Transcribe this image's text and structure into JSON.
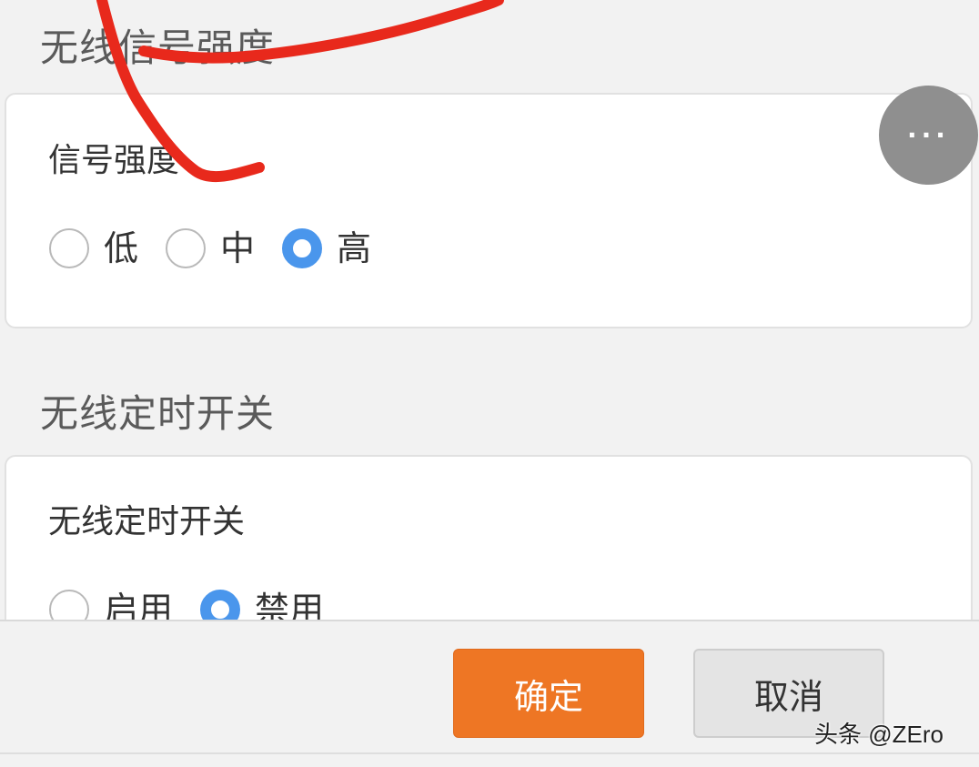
{
  "signal_section": {
    "title": "无线信号强度",
    "field_label": "信号强度",
    "options": [
      {
        "label": "低",
        "checked": false
      },
      {
        "label": "中",
        "checked": false
      },
      {
        "label": "高",
        "checked": true
      }
    ]
  },
  "timer_section": {
    "title": "无线定时开关",
    "field_label": "无线定时开关",
    "options": [
      {
        "label": "启用",
        "checked": false
      },
      {
        "label": "禁用",
        "checked": true
      }
    ]
  },
  "more_button": {
    "icon": "more-dots-icon",
    "glyph": "···"
  },
  "footer": {
    "confirm_label": "确定",
    "cancel_label": "取消"
  },
  "watermark": "头条 @ZEro",
  "colors": {
    "accent_radio": "#4a96ec",
    "confirm_button": "#ee7624",
    "annotation_stroke": "#e8291c"
  }
}
